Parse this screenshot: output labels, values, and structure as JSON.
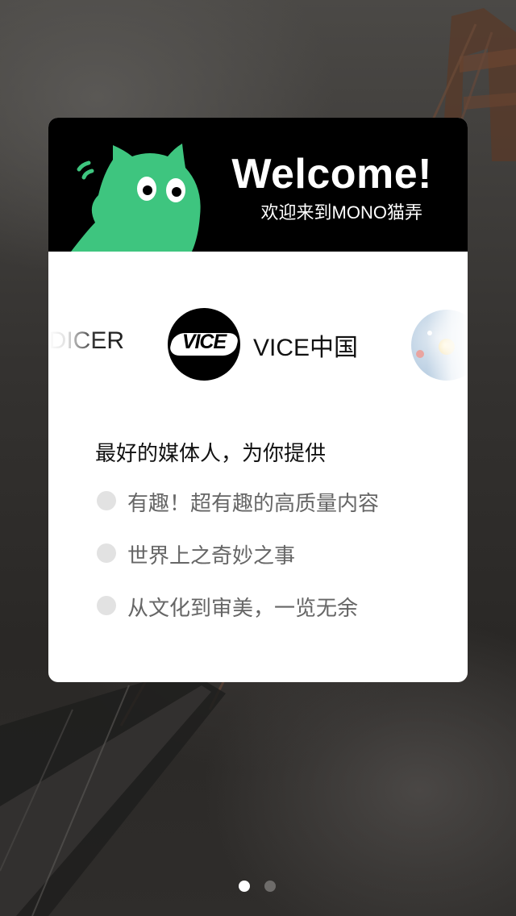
{
  "welcome": {
    "title": "Welcome!",
    "subtitle": "欢迎来到MONO猫弄",
    "mascot_icon": "green-cat-mascot-icon",
    "mascot_color": "#3ec57f"
  },
  "partners": {
    "previous_label": "DICER",
    "current_label": "VICE中国",
    "current_logo_text": "VICE",
    "next_icon": "planet-logo-icon"
  },
  "intro": "最好的媒体人，为你提供",
  "features": [
    {
      "text": "有趣！超有趣的高质量内容"
    },
    {
      "text": "世界上之奇妙之事"
    },
    {
      "text": "从文化到审美，一览无余"
    }
  ],
  "pager": {
    "total": 2,
    "active_index": 0,
    "active_color": "#ffffff",
    "inactive_color": "#6e6c6a"
  }
}
